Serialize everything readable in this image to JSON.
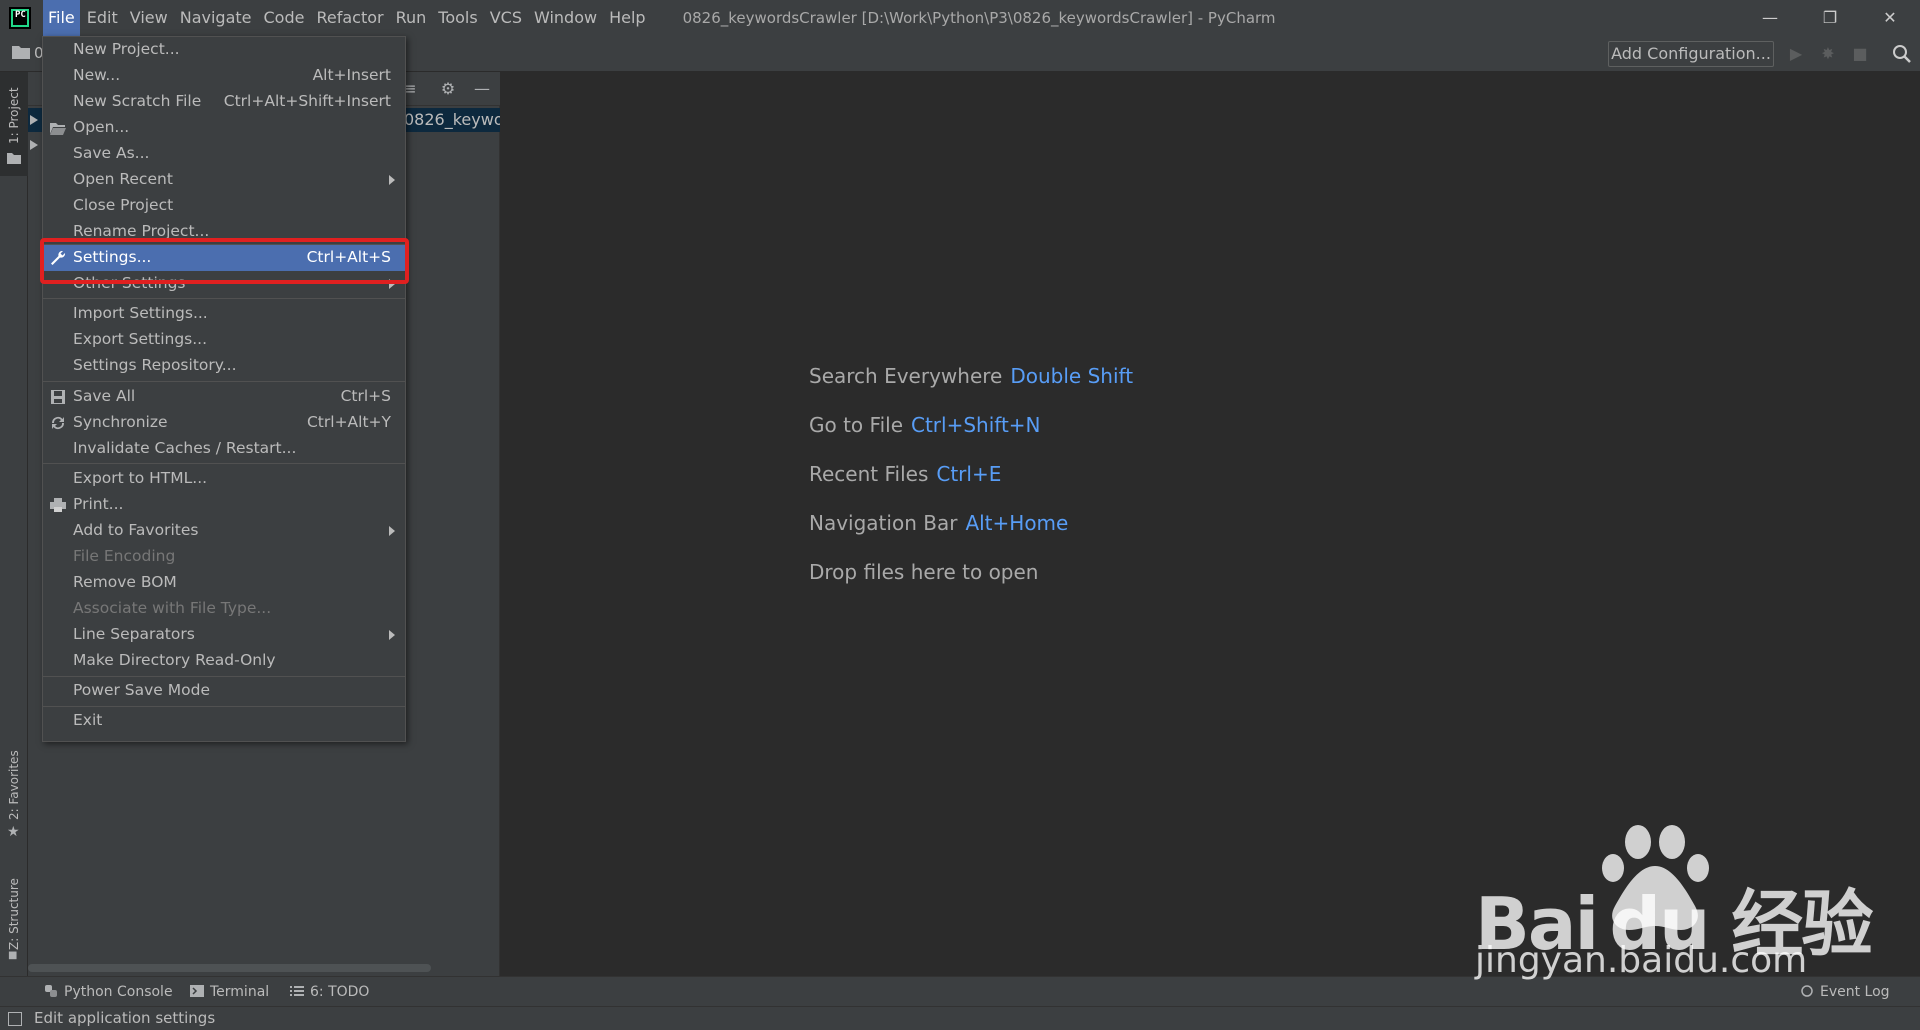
{
  "menubar": {
    "items": [
      "File",
      "Edit",
      "View",
      "Navigate",
      "Code",
      "Refactor",
      "Run",
      "Tools",
      "VCS",
      "Window",
      "Help"
    ],
    "window_title": "0826_keywordsCrawler [D:\\Work\\Python\\P3\\0826_keywordsCrawler] - PyCharm",
    "app_logo_text": "PC"
  },
  "toolbar": {
    "breadcrumb_text": "0",
    "add_config_label": "Add Configuration..."
  },
  "left_strip": {
    "project_tab": "1: Project",
    "favorites_tab": "2: Favorites",
    "structure_tab": "Z: Structure"
  },
  "project_panel": {
    "selected_node_partial": "0826_keywor"
  },
  "file_menu": {
    "items": [
      {
        "label": "New Project...",
        "shortcut": "",
        "icon": "",
        "submenu": false,
        "disabled": false
      },
      {
        "label": "New...",
        "shortcut": "Alt+Insert",
        "icon": "",
        "submenu": false,
        "disabled": false
      },
      {
        "label": "New Scratch File",
        "shortcut": "Ctrl+Alt+Shift+Insert",
        "icon": "",
        "submenu": false,
        "disabled": false
      },
      {
        "label": "Open...",
        "shortcut": "",
        "icon": "folder-open-icon",
        "submenu": false,
        "disabled": false
      },
      {
        "label": "Save As...",
        "shortcut": "",
        "icon": "",
        "submenu": false,
        "disabled": false
      },
      {
        "label": "Open Recent",
        "shortcut": "",
        "icon": "",
        "submenu": true,
        "disabled": false
      },
      {
        "label": "Close Project",
        "shortcut": "",
        "icon": "",
        "submenu": false,
        "disabled": false
      },
      {
        "label": "Rename Project...",
        "shortcut": "",
        "icon": "",
        "submenu": false,
        "disabled": false
      },
      {
        "label": "Settings...",
        "shortcut": "Ctrl+Alt+S",
        "icon": "wrench-icon",
        "submenu": false,
        "disabled": false
      },
      {
        "label": "Other Settings",
        "shortcut": "",
        "icon": "",
        "submenu": true,
        "disabled": false
      },
      {
        "label": "Import Settings...",
        "shortcut": "",
        "icon": "",
        "submenu": false,
        "disabled": false
      },
      {
        "label": "Export Settings...",
        "shortcut": "",
        "icon": "",
        "submenu": false,
        "disabled": false
      },
      {
        "label": "Settings Repository...",
        "shortcut": "",
        "icon": "",
        "submenu": false,
        "disabled": false
      },
      {
        "label": "Save All",
        "shortcut": "Ctrl+S",
        "icon": "save-icon",
        "submenu": false,
        "disabled": false
      },
      {
        "label": "Synchronize",
        "shortcut": "Ctrl+Alt+Y",
        "icon": "sync-icon",
        "submenu": false,
        "disabled": false
      },
      {
        "label": "Invalidate Caches / Restart...",
        "shortcut": "",
        "icon": "",
        "submenu": false,
        "disabled": false
      },
      {
        "label": "Export to HTML...",
        "shortcut": "",
        "icon": "",
        "submenu": false,
        "disabled": false
      },
      {
        "label": "Print...",
        "shortcut": "",
        "icon": "printer-icon",
        "submenu": false,
        "disabled": false
      },
      {
        "label": "Add to Favorites",
        "shortcut": "",
        "icon": "",
        "submenu": true,
        "disabled": false
      },
      {
        "label": "File Encoding",
        "shortcut": "",
        "icon": "",
        "submenu": false,
        "disabled": true
      },
      {
        "label": "Remove BOM",
        "shortcut": "",
        "icon": "",
        "submenu": false,
        "disabled": false
      },
      {
        "label": "Associate with File Type...",
        "shortcut": "",
        "icon": "",
        "submenu": false,
        "disabled": true
      },
      {
        "label": "Line Separators",
        "shortcut": "",
        "icon": "",
        "submenu": true,
        "disabled": false
      },
      {
        "label": "Make Directory Read-Only",
        "shortcut": "",
        "icon": "",
        "submenu": false,
        "disabled": false
      },
      {
        "label": "Power Save Mode",
        "shortcut": "",
        "icon": "",
        "submenu": false,
        "disabled": false
      },
      {
        "label": "Exit",
        "shortcut": "",
        "icon": "",
        "submenu": false,
        "disabled": false
      }
    ],
    "selected_label": "Settings..."
  },
  "welcome": {
    "hints": [
      {
        "label": "Search Everywhere",
        "shortcut": "Double Shift"
      },
      {
        "label": "Go to File",
        "shortcut": "Ctrl+Shift+N"
      },
      {
        "label": "Recent Files",
        "shortcut": "Ctrl+E"
      },
      {
        "label": "Navigation Bar",
        "shortcut": "Alt+Home"
      },
      {
        "label": "Drop files here to open",
        "shortcut": ""
      }
    ]
  },
  "bottom_tabs": {
    "python_console": "Python Console",
    "terminal": "Terminal",
    "todo": "6: TODO",
    "event_log": "Event Log"
  },
  "status_bar": {
    "text": "Edit application settings"
  },
  "watermark": {
    "brand": "Bai du 经验",
    "url": "jingyan.baidu.com"
  },
  "colors": {
    "background": "#2b2b2b",
    "panel": "#3c3f41",
    "selection": "#4b6eaf",
    "shortcut_link": "#589df6",
    "highlight_box": "#e02020"
  }
}
